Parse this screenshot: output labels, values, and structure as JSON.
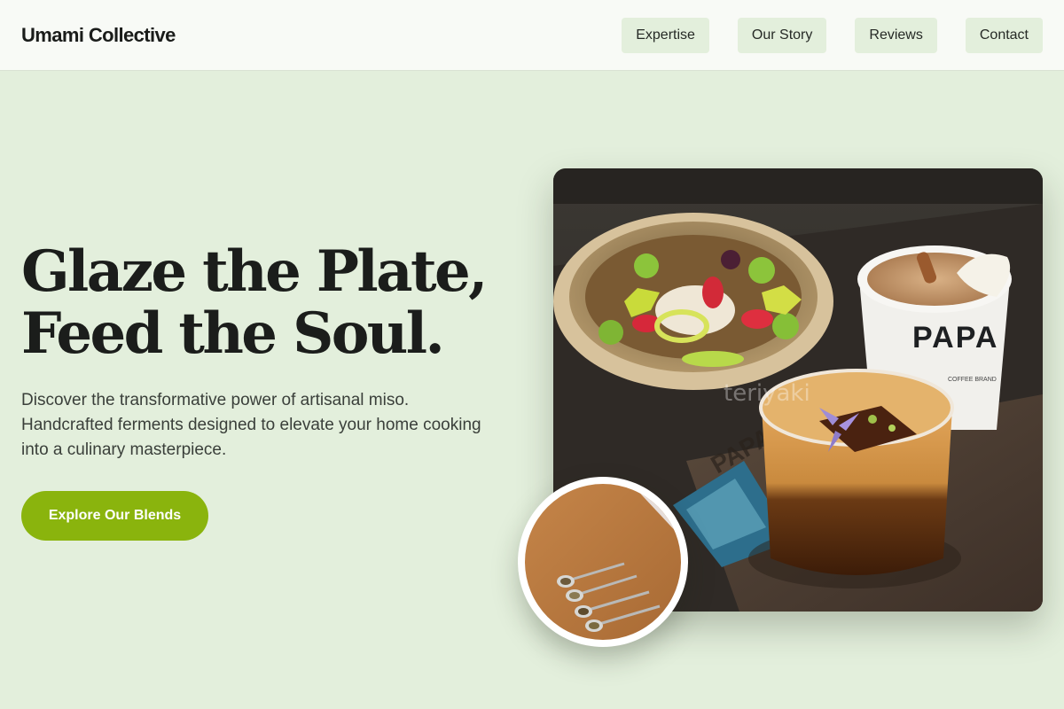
{
  "header": {
    "brand": "Umami Collective",
    "nav": [
      {
        "label": "Expertise"
      },
      {
        "label": "Our Story"
      },
      {
        "label": "Reviews"
      },
      {
        "label": "Contact"
      }
    ]
  },
  "hero": {
    "title_line1": "Glaze the Plate,",
    "title_line2": "Feed the Soul.",
    "subtitle": "Discover the transformative power of artisanal miso. Handcrafted ferments designed to elevate your home cooking into a culinary masterpiece.",
    "cta_label": "Explore Our Blends"
  },
  "photo": {
    "cup_print": "PAPA",
    "cup_small_print": "COFFEE BRAND",
    "watermark": "teriyaki",
    "tray_print": "PAPA"
  },
  "colors": {
    "page_bg": "#e3efdc",
    "header_bg": "#f8faf6",
    "nav_bg": "#e3efdc",
    "accent": "#8ab40d"
  }
}
